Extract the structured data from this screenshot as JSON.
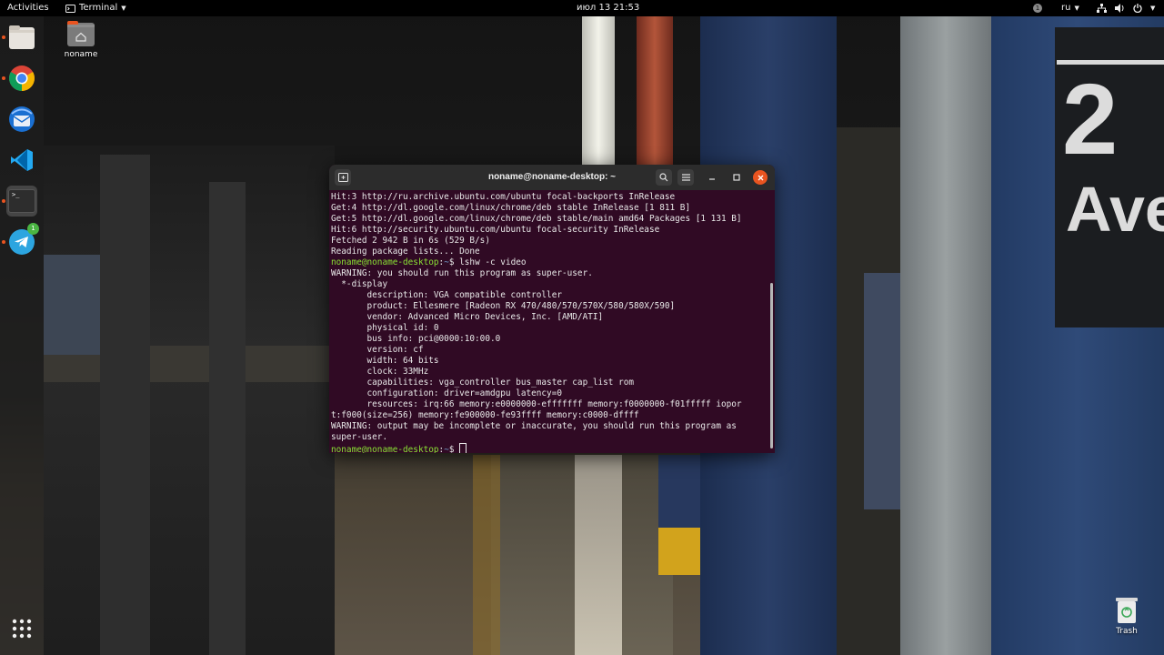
{
  "topbar": {
    "activities": "Activities",
    "app_menu": "Terminal",
    "clock": "июл 13  21:53",
    "notification_count": "1",
    "keyboard_layout": "ru"
  },
  "dock": {
    "items": [
      "Files",
      "Google Chrome",
      "Thunderbird",
      "Visual Studio Code",
      "Terminal",
      "Telegram"
    ],
    "telegram_badge": "1",
    "terminal_glyph": ">_"
  },
  "desktop": {
    "home_folder_label": "noname",
    "trash_label": "Trash"
  },
  "terminal": {
    "title": "noname@noname-desktop: ~",
    "lines": [
      {
        "type": "out",
        "text": "Hit:3 http://ru.archive.ubuntu.com/ubuntu focal-backports InRelease"
      },
      {
        "type": "out",
        "text": "Get:4 http://dl.google.com/linux/chrome/deb stable InRelease [1 811 B]"
      },
      {
        "type": "out",
        "text": "Get:5 http://dl.google.com/linux/chrome/deb stable/main amd64 Packages [1 131 B]"
      },
      {
        "type": "out",
        "text": "Hit:6 http://security.ubuntu.com/ubuntu focal-security InRelease"
      },
      {
        "type": "out",
        "text": "Fetched 2 942 B in 6s (529 B/s)"
      },
      {
        "type": "out",
        "text": "Reading package lists... Done"
      },
      {
        "type": "prompt",
        "user": "noname@noname-desktop",
        "path": "~",
        "cmd": "lshw -c video"
      },
      {
        "type": "out",
        "text": "WARNING: you should run this program as super-user."
      },
      {
        "type": "out",
        "text": "  *-display"
      },
      {
        "type": "out",
        "text": "       description: VGA compatible controller"
      },
      {
        "type": "out",
        "text": "       product: Ellesmere [Radeon RX 470/480/570/570X/580/580X/590]"
      },
      {
        "type": "out",
        "text": "       vendor: Advanced Micro Devices, Inc. [AMD/ATI]"
      },
      {
        "type": "out",
        "text": "       physical id: 0"
      },
      {
        "type": "out",
        "text": "       bus info: pci@0000:10:00.0"
      },
      {
        "type": "out",
        "text": "       version: cf"
      },
      {
        "type": "out",
        "text": "       width: 64 bits"
      },
      {
        "type": "out",
        "text": "       clock: 33MHz"
      },
      {
        "type": "out",
        "text": "       capabilities: vga_controller bus_master cap_list rom"
      },
      {
        "type": "out",
        "text": "       configuration: driver=amdgpu latency=0"
      },
      {
        "type": "out",
        "text": "       resources: irq:66 memory:e0000000-efffffff memory:f0000000-f01fffff iopor"
      },
      {
        "type": "out",
        "text": "t:f000(size=256) memory:fe900000-fe93ffff memory:c0000-dffff"
      },
      {
        "type": "out",
        "text": "WARNING: output may be incomplete or inaccurate, you should run this program as"
      },
      {
        "type": "out",
        "text": "super-user."
      },
      {
        "type": "prompt",
        "user": "noname@noname-desktop",
        "path": "~",
        "cmd": ""
      }
    ]
  },
  "wallpaper": {
    "sign_number": "2",
    "sign_text": "Ave"
  },
  "colors": {
    "terminal_bg": "#300a24",
    "prompt_user": "#8ae234",
    "prompt_path": "#729fcf",
    "ubuntu_orange": "#e95420"
  }
}
